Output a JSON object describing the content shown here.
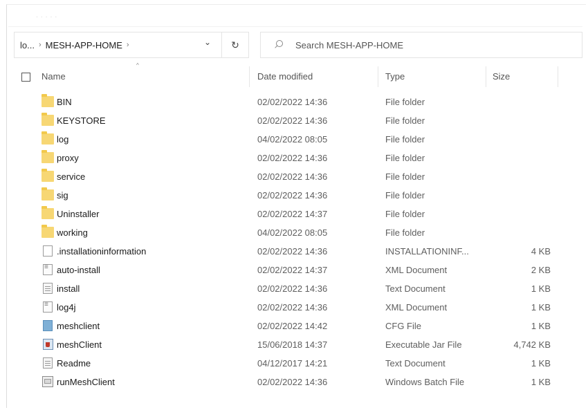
{
  "window": {
    "title_faint": "· · · · ·"
  },
  "address": {
    "overflow": "lo...",
    "separator": "›",
    "current": "MESH-APP-HOME",
    "trailing_separator": "›",
    "dropdown_glyph": "⌄",
    "refresh_glyph": "↻"
  },
  "search": {
    "placeholder": "Search MESH-APP-HOME"
  },
  "columns": {
    "name": "Name",
    "date_modified": "Date modified",
    "type": "Type",
    "size": "Size",
    "sort_glyph": "^"
  },
  "files": [
    {
      "name": "BIN",
      "date": "02/02/2022 14:36",
      "type": "File folder",
      "size": "",
      "icon": "folder-icon"
    },
    {
      "name": "KEYSTORE",
      "date": "02/02/2022 14:36",
      "type": "File folder",
      "size": "",
      "icon": "folder-icon"
    },
    {
      "name": "log",
      "date": "04/02/2022 08:05",
      "type": "File folder",
      "size": "",
      "icon": "folder-icon"
    },
    {
      "name": "proxy",
      "date": "02/02/2022 14:36",
      "type": "File folder",
      "size": "",
      "icon": "folder-icon"
    },
    {
      "name": "service",
      "date": "02/02/2022 14:36",
      "type": "File folder",
      "size": "",
      "icon": "folder-icon"
    },
    {
      "name": "sig",
      "date": "02/02/2022 14:36",
      "type": "File folder",
      "size": "",
      "icon": "folder-icon"
    },
    {
      "name": "Uninstaller",
      "date": "02/02/2022 14:37",
      "type": "File folder",
      "size": "",
      "icon": "folder-icon"
    },
    {
      "name": "working",
      "date": "04/02/2022 08:05",
      "type": "File folder",
      "size": "",
      "icon": "folder-icon"
    },
    {
      "name": ".installationinformation",
      "date": "02/02/2022 14:36",
      "type": "INSTALLATIONINF...",
      "size": "4 KB",
      "icon": "blank-file-icon"
    },
    {
      "name": "auto-install",
      "date": "02/02/2022 14:37",
      "type": "XML Document",
      "size": "2 KB",
      "icon": "xml-document-icon"
    },
    {
      "name": "install",
      "date": "02/02/2022 14:36",
      "type": "Text Document",
      "size": "1 KB",
      "icon": "text-document-icon"
    },
    {
      "name": "log4j",
      "date": "02/02/2022 14:36",
      "type": "XML Document",
      "size": "1 KB",
      "icon": "xml-document-icon"
    },
    {
      "name": "meshclient",
      "date": "02/02/2022 14:42",
      "type": "CFG File",
      "size": "1 KB",
      "icon": "cfg-file-icon"
    },
    {
      "name": "meshClient",
      "date": "15/06/2018 14:37",
      "type": "Executable Jar File",
      "size": "4,742 KB",
      "icon": "jar-file-icon"
    },
    {
      "name": "Readme",
      "date": "04/12/2017 14:21",
      "type": "Text Document",
      "size": "1 KB",
      "icon": "text-document-icon"
    },
    {
      "name": "runMeshClient",
      "date": "02/02/2022 14:36",
      "type": "Windows Batch File",
      "size": "1 KB",
      "icon": "batch-file-icon"
    }
  ]
}
